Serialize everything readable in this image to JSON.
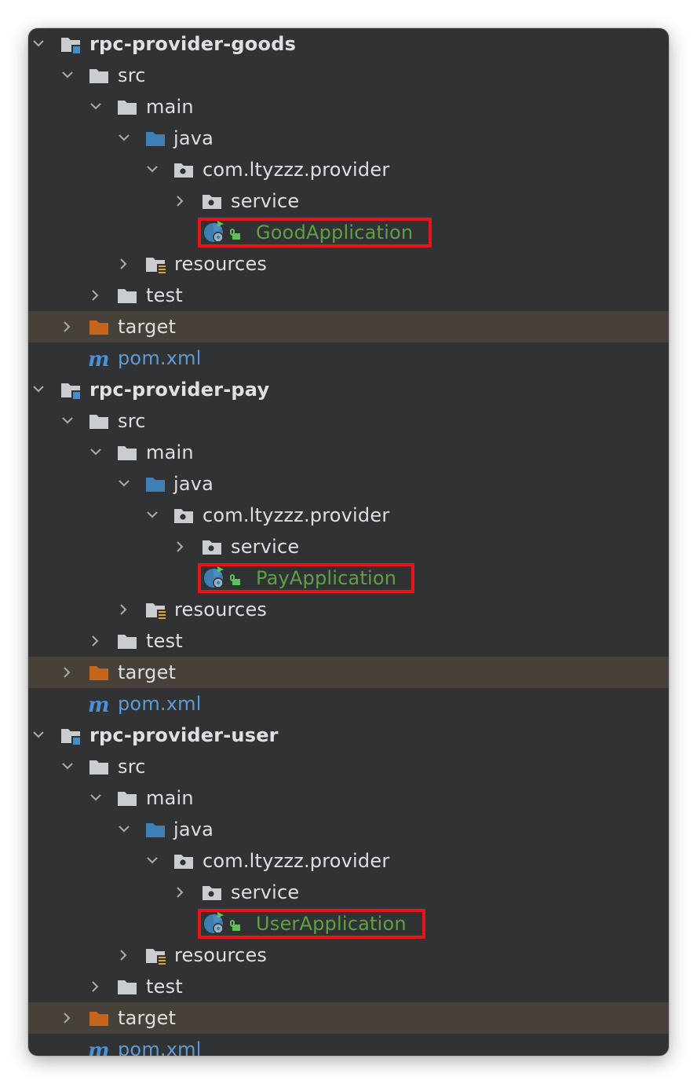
{
  "colors": {
    "panel_bg": "#303234",
    "target_row_bg": "#47413a",
    "folder_gray": "#c9ccd1",
    "folder_blue": "#3f7fb5",
    "folder_orange": "#c5651c",
    "app_text_green": "#5fa045",
    "xml_text_blue": "#5e9bd4",
    "highlight_box_red": "#e8141a"
  },
  "modules": [
    {
      "name": "rpc-provider-goods",
      "src": "src",
      "main": "main",
      "java": "java",
      "package": "com.ltyzzz.provider",
      "service": "service",
      "app_class": "GoodApplication",
      "resources": "resources",
      "test": "test",
      "target": "target",
      "pom": "pom.xml"
    },
    {
      "name": "rpc-provider-pay",
      "src": "src",
      "main": "main",
      "java": "java",
      "package": "com.ltyzzz.provider",
      "service": "service",
      "app_class": "PayApplication",
      "resources": "resources",
      "test": "test",
      "target": "target",
      "pom": "pom.xml"
    },
    {
      "name": "rpc-provider-user",
      "src": "src",
      "main": "main",
      "java": "java",
      "package": "com.ltyzzz.provider",
      "service": "service",
      "app_class": "UserApplication",
      "resources": "resources",
      "test": "test",
      "target": "target",
      "pom": "pom.xml"
    }
  ],
  "icons": {
    "module": "module-folder-icon",
    "folder": "folder-icon",
    "source_root": "source-root-folder-icon",
    "package": "package-icon",
    "spring_app": "spring-boot-application-icon",
    "resources": "resources-folder-icon",
    "excluded": "excluded-folder-icon",
    "maven": "maven-icon"
  }
}
